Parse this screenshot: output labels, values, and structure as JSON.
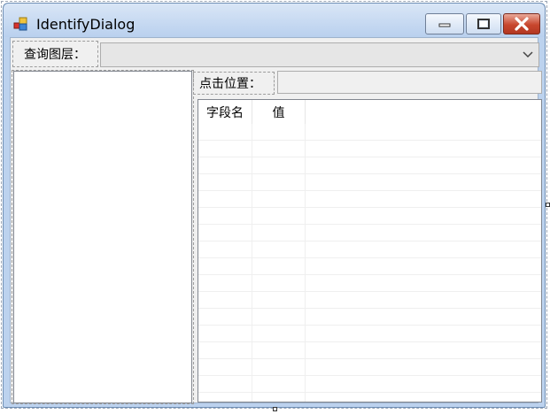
{
  "window": {
    "title": "IdentifyDialog",
    "controls": {
      "minimize": "minimize",
      "maximize": "maximize",
      "close": "close"
    }
  },
  "query_layer": {
    "label": "查询图层：",
    "selected_value": ""
  },
  "click_position": {
    "label": "点击位置：",
    "value": ""
  },
  "attribute_grid": {
    "columns": [
      "字段名",
      "值"
    ],
    "rows": []
  },
  "colors": {
    "title_bar": "#bcd2ee",
    "client_bg": "#f0f0f0",
    "close_button": "#c8472e"
  },
  "icons": [
    "app-icon",
    "minimize-icon",
    "maximize-icon",
    "close-icon",
    "chevron-down-icon"
  ]
}
